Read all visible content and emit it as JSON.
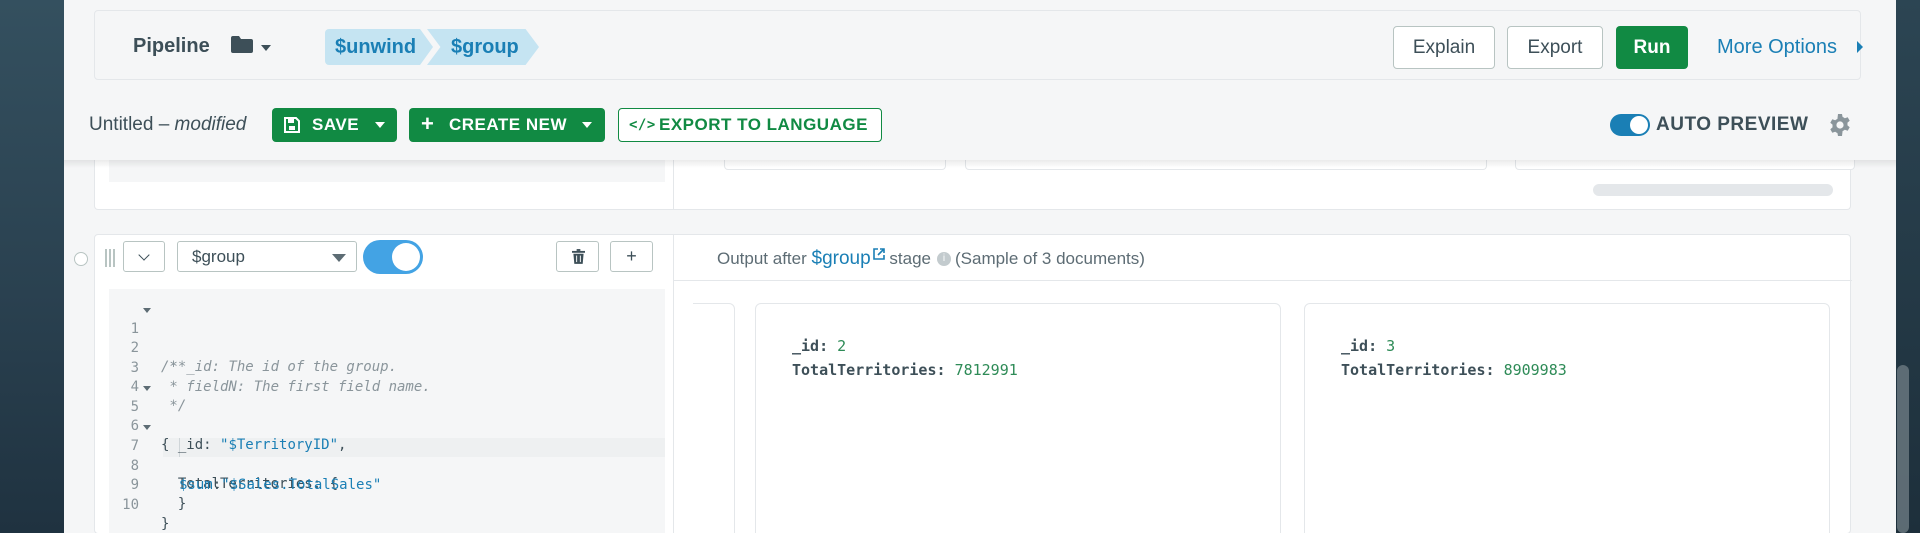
{
  "toolbar": {
    "pipeline_label": "Pipeline",
    "stages": [
      "$unwind",
      "$group"
    ],
    "explain_label": "Explain",
    "export_label": "Export",
    "run_label": "Run",
    "more_options_label": "More Options"
  },
  "save_row": {
    "title": "Untitled",
    "separator": " – ",
    "modified": "modified",
    "save_label": "SAVE",
    "create_new_label": "CREATE NEW",
    "export_language_label": "EXPORT TO LANGUAGE",
    "auto_preview_label": "AUTO PREVIEW",
    "auto_preview_on": true
  },
  "stage": {
    "operator": "$group",
    "enabled": true,
    "add_label": "+",
    "code_lines": [
      {
        "n": "1",
        "fold": true
      },
      {
        "n": "2",
        "fold": false
      },
      {
        "n": "3",
        "fold": false
      },
      {
        "n": "4",
        "fold": false
      },
      {
        "n": "5",
        "fold": true
      },
      {
        "n": "6",
        "fold": false
      },
      {
        "n": "7",
        "fold": true
      },
      {
        "n": "8",
        "fold": false
      },
      {
        "n": "9",
        "fold": false
      },
      {
        "n": "10",
        "fold": false
      }
    ],
    "code": {
      "l1": "/**",
      "l2": " * _id: The id of the group.",
      "l3": " * fieldN: The first field name.",
      "l4": " */",
      "l5": "{",
      "l6_key": "  _id: ",
      "l6_val": "\"$TerritoryID\"",
      "l6_end": ",",
      "l7": "  TotalTerritories: {",
      "l8_op": "$sum",
      "l8_colon": ":",
      "l8_val": "\"$Sales.TotalSales\"",
      "l9": "  }",
      "l10": "}"
    },
    "output": {
      "prefix": "Output after ",
      "stage_link": "$group",
      "middle": " stage",
      "sample": "(Sample of 3 documents)",
      "documents": [
        {
          "id_key": "_id",
          "id_val": "2",
          "field_key": "TotalTerritories",
          "field_val": "7812991"
        },
        {
          "id_key": "_id",
          "id_val": "3",
          "field_key": "TotalTerritories",
          "field_val": "8909983"
        }
      ]
    }
  },
  "colors": {
    "accent_green": "#118a43",
    "link_blue": "#1a7fb5",
    "pill_bg": "#c5e4f2"
  }
}
